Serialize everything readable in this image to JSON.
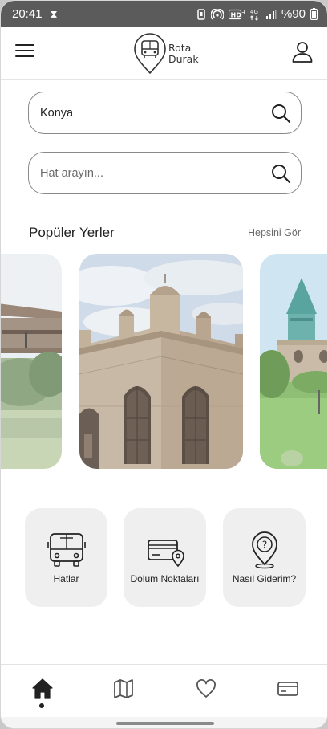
{
  "status_bar": {
    "time": "20:41",
    "network": "4G",
    "battery_text": "%90",
    "icons": [
      "hourglass-icon",
      "vibrate-icon",
      "hotspot-icon",
      "hd-icon",
      "data-arrows-icon",
      "signal-icon",
      "battery-icon"
    ]
  },
  "header": {
    "logo_line1": "Rota",
    "logo_line2": "Durak",
    "icons": [
      "hamburger-menu-icon",
      "bus-pin-logo-icon",
      "user-profile-icon"
    ]
  },
  "search": {
    "city_value": "Konya",
    "line_placeholder": "Hat arayın..."
  },
  "popular": {
    "title": "Popüler Yerler",
    "see_all": "Hepsini Gör",
    "active_index": 1
  },
  "tiles": [
    {
      "label": "Hatlar",
      "icon": "bus-icon"
    },
    {
      "label": "Dolum Noktaları",
      "icon": "card-location-icon"
    },
    {
      "label": "Nasıl Giderim?",
      "icon": "question-pin-icon"
    }
  ],
  "bottom_nav": {
    "items": [
      "home-icon",
      "map-icon",
      "heart-icon",
      "wallet-card-icon"
    ],
    "active": "home-icon"
  },
  "colors": {
    "status_bar": "#5b5b5b",
    "tile_bg": "#efefef",
    "border": "#8a8a8a"
  }
}
